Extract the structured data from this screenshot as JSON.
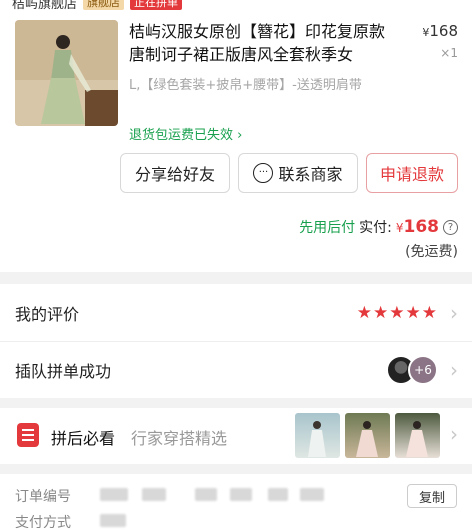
{
  "store": {
    "name": "桔屿旗舰店",
    "tag": "旗舰店",
    "tag2": "正在拼单"
  },
  "product": {
    "title": "桔屿汉服女原创【簪花】印花复原款唐制诃子裙正版唐风全套秋季女",
    "price_symbol": "¥",
    "price": "168",
    "qty": "×1",
    "spec": "L,【绿色套装+披帛+腰带】-送透明肩带",
    "policy": "退货包运费已失效"
  },
  "actions": {
    "share": "分享给好友",
    "contact": "联系商家",
    "refund": "申请退款"
  },
  "payment": {
    "pay_later": "先用后付",
    "label": "实付:",
    "currency": "¥",
    "amount": "168",
    "shipping": "(免运费)"
  },
  "review": {
    "label": "我的评价",
    "stars": "★★★★★"
  },
  "group": {
    "label": "插队拼单成功",
    "extra_count": "+6"
  },
  "recommend": {
    "title": "拼后必看",
    "subtitle": "行家穿搭精选"
  },
  "order_info": {
    "order_no_label": "订单编号",
    "pay_method_label": "支付方式",
    "copy": "复制"
  },
  "colors": {
    "accent": "#e4393c",
    "green": "#18a04e"
  }
}
